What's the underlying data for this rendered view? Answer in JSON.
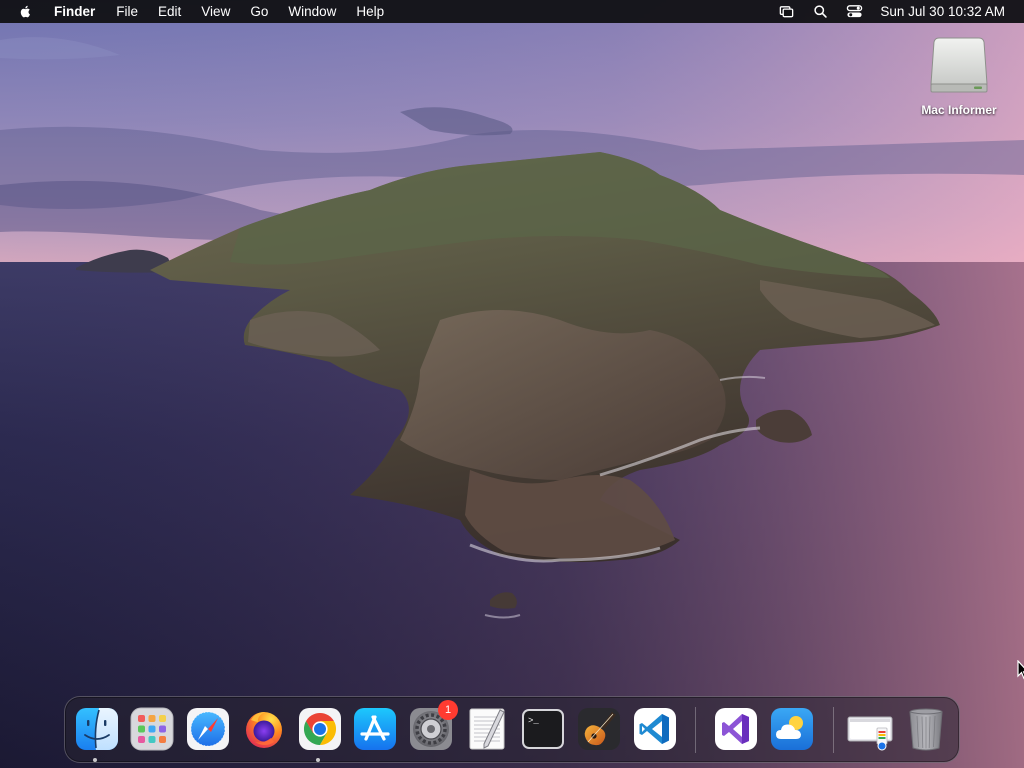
{
  "menubar": {
    "apple_icon": "apple-logo-icon",
    "app_name": "Finder",
    "menus": [
      "File",
      "Edit",
      "View",
      "Go",
      "Window",
      "Help"
    ],
    "status_icons": [
      "screen-mirroring-icon",
      "spotlight-search-icon",
      "control-center-icon"
    ],
    "clock": "Sun Jul 30  10:32 AM"
  },
  "desktop": {
    "wallpaper": "macOS Catalina island wallpaper",
    "items": [
      {
        "label": "Mac Informer",
        "icon": "external-drive-icon"
      }
    ]
  },
  "dock": {
    "apps": [
      {
        "name": "finder",
        "icon": "finder-icon",
        "running": true
      },
      {
        "name": "launchpad",
        "icon": "launchpad-icon",
        "running": false
      },
      {
        "name": "safari",
        "icon": "safari-icon",
        "running": false
      },
      {
        "name": "firefox",
        "icon": "firefox-icon",
        "running": false
      },
      {
        "name": "chrome",
        "icon": "chrome-icon",
        "running": true
      },
      {
        "name": "app-store",
        "icon": "app-store-icon",
        "running": false
      },
      {
        "name": "system-preferences",
        "icon": "system-preferences-icon",
        "running": false,
        "badge": "1"
      },
      {
        "name": "textedit",
        "icon": "textedit-icon",
        "running": false
      },
      {
        "name": "terminal",
        "icon": "terminal-icon",
        "running": false
      },
      {
        "name": "garageband",
        "icon": "garageband-icon",
        "running": false
      },
      {
        "name": "vscode",
        "icon": "vscode-icon",
        "running": false
      },
      {
        "name": "visual-studio",
        "icon": "visual-studio-icon",
        "running": false
      },
      {
        "name": "weather",
        "icon": "weather-icon",
        "running": false
      },
      {
        "name": "downloads-stack",
        "icon": "downloads-stack-icon",
        "running": false
      },
      {
        "name": "trash",
        "icon": "trash-icon",
        "running": false
      }
    ],
    "terminal_prompt": ">_"
  },
  "colors": {
    "menubar_bg": "#121216",
    "badge": "#ff3b30",
    "sky_top": "#7d7bb5",
    "sea": "#262344"
  }
}
